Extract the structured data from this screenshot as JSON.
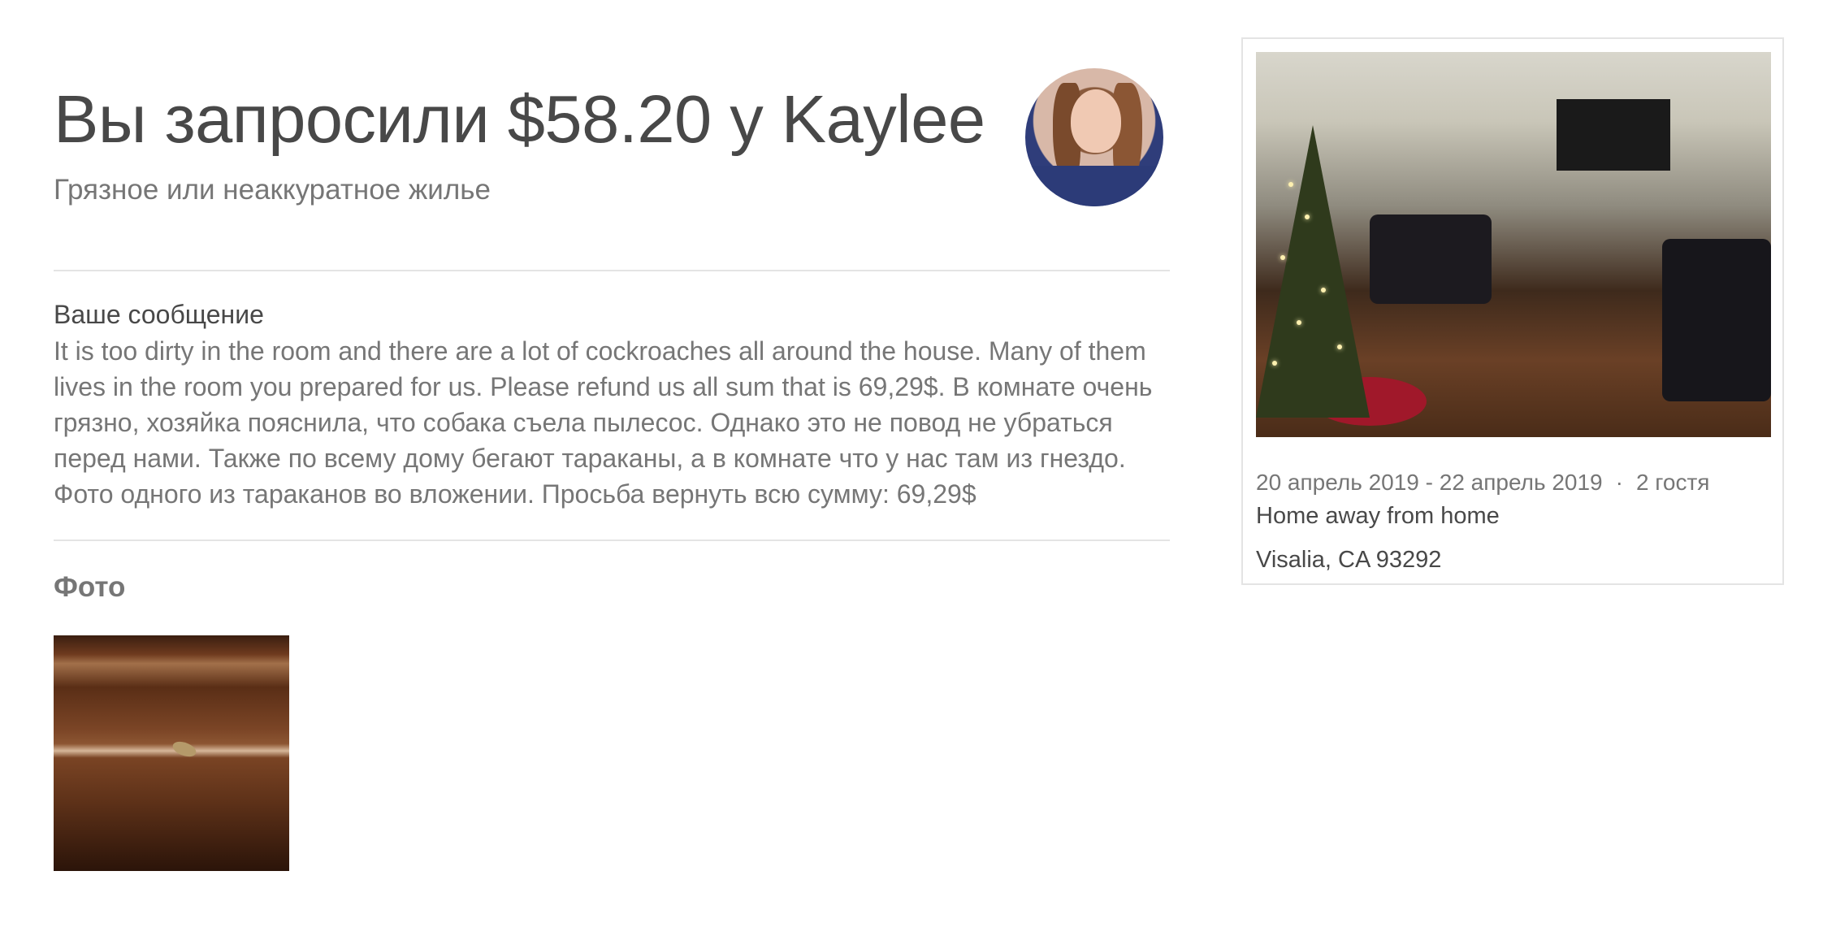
{
  "request": {
    "title": "Вы запросили $58.20 у Kaylee",
    "reason": "Грязное или неаккуратное жилье",
    "message_heading": "Ваше сообщение",
    "message": "It is too dirty in the room and there are a lot of cockroaches all around the house. Many of them lives in the room you prepared for us. Please refund us all sum that is 69,29$. В комнате очень грязно, хозяйка пояснила, что собака съела пылесос. Однако это не повод не убраться перед нами. Также по всему дому бегают тараканы, а в комнате что у нас там из гнездо. Фото одного из тараканов во вложении. Просьба вернуть всю сумму: 69,29$",
    "photos_heading": "Фото"
  },
  "reservation": {
    "dates": "20 апрель 2019 - 22 апрель 2019",
    "separator": "·",
    "guests": "2 гостя",
    "listing_name": "Home away from home",
    "location": "Visalia, CA 93292"
  }
}
